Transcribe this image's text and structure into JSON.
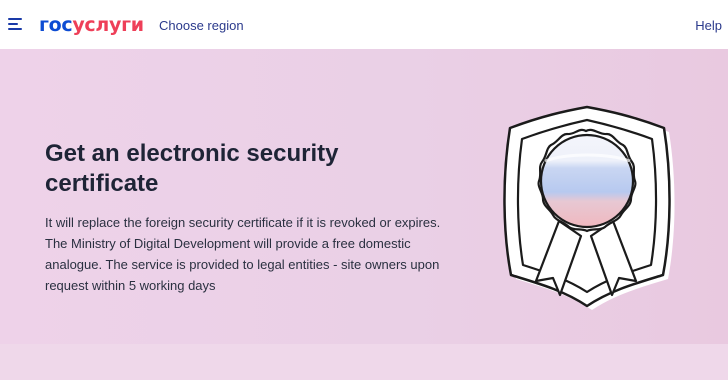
{
  "header": {
    "logo_part1": "гос",
    "logo_part2": "услуги",
    "region_label": "Choose region",
    "help_label": "Help"
  },
  "hero": {
    "title": "Get an electronic security certificate",
    "description": "It will replace the foreign security certificate if it is revoked or expires. The Ministry of Digital Development will provide a free domestic analogue. The service is provided to legal entities - site owners upon request within 5 working days",
    "illustration": "certificate-badge-icon"
  },
  "colors": {
    "brand_blue": "#0d4cd3",
    "brand_red": "#ee3f58",
    "hero_background": "#ead0e6",
    "header_background": "#ffffff",
    "link": "#2b3a8c"
  }
}
